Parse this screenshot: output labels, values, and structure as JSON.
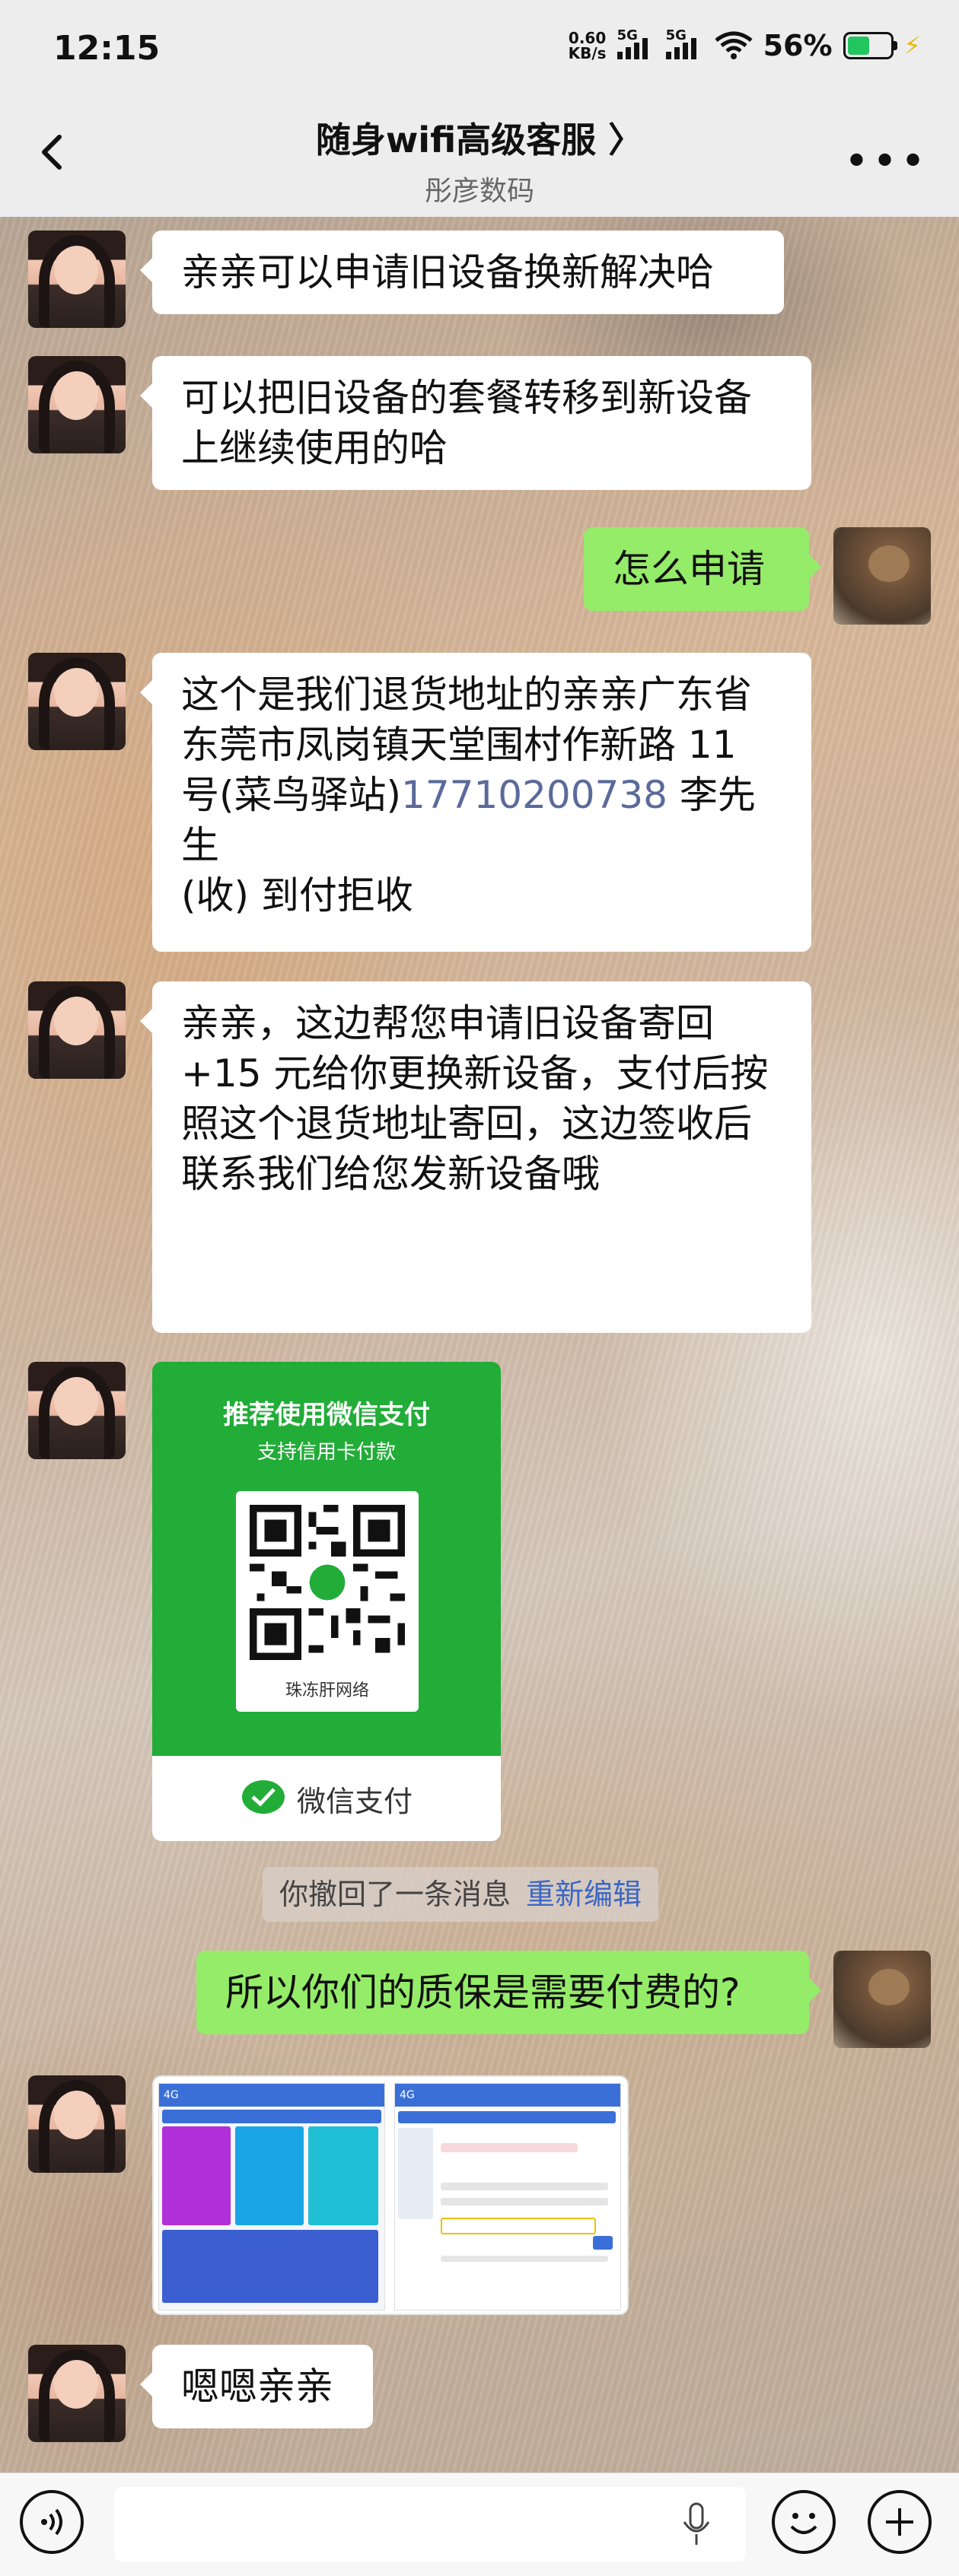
{
  "status_bar": {
    "time": "12:15",
    "net_speed_value": "0.60",
    "net_speed_unit": "KB/s",
    "signal1_label": "5G",
    "signal2_label": "5G",
    "battery_percent": "56%",
    "battery_level": 0.56,
    "battery_color": "#23c55e"
  },
  "header": {
    "title": "随身wifi高级客服 〉",
    "subtitle": "彤彦数码"
  },
  "messages": [
    {
      "side": "in",
      "text": "亲亲可以申请旧设备换新解决哈"
    },
    {
      "side": "in",
      "text_lines": [
        "可以把旧设备的套餐转移到新设备",
        "上继续使用的哈"
      ]
    },
    {
      "side": "out",
      "text": "怎么申请"
    },
    {
      "side": "in",
      "text_lines": [
        "这个是我们退货地址的亲亲广东省",
        "东莞市凤岗镇天堂围村作新路 11"
      ],
      "line3_prefix": "号(菜鸟驿站)",
      "phone": "17710200738",
      "line3_suffix": " 李先生",
      "line4": "(收) 到付拒收"
    },
    {
      "side": "in",
      "text_lines": [
        "亲亲，这边帮您申请旧设备寄回",
        "+15 元给你更换新设备，支付后按",
        "照这个退货地址寄回，这边签收后",
        "联系我们给您发新设备哦"
      ]
    },
    {
      "side": "in",
      "type": "pay_card",
      "title": "推荐使用微信支付",
      "subtitle": "支持信用卡付款",
      "payee": "珠冻肝网络",
      "footer": "微信支付"
    },
    {
      "side": "system",
      "text": "你撤回了一条消息",
      "action": "重新编辑"
    },
    {
      "side": "out",
      "text": "所以你们的质保是需要付费的?"
    },
    {
      "side": "in",
      "type": "image",
      "left_label": "4G",
      "right_label": "4G"
    },
    {
      "side": "in",
      "text": "嗯嗯亲亲"
    }
  ],
  "colors": {
    "out_bubble": "#95ec69",
    "in_bubble": "#ffffff",
    "wechat_green": "#22ac38",
    "link_blue": "#3b67c4"
  },
  "input_bar": {
    "voice_icon": "voice-icon",
    "mic_icon": "mic-icon",
    "emoji_icon": "emoji-icon",
    "plus_icon": "plus-icon"
  }
}
